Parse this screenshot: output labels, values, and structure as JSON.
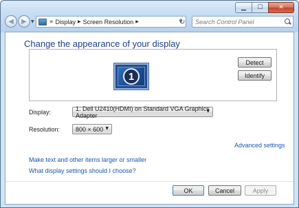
{
  "window": {
    "caption": {
      "minimize_glyph": "▁",
      "maximize_glyph": "☐",
      "close_glyph": "✕"
    }
  },
  "nav": {
    "back_glyph": "◀",
    "forward_glyph": "▶",
    "dropdown_glyph": "▼",
    "refresh_glyph": "↻"
  },
  "address": {
    "overflow": "«",
    "crumbs": [
      "Display",
      "Screen Resolution"
    ],
    "separator": "▶",
    "dropdown_glyph": "▼"
  },
  "search": {
    "placeholder": "Search Control Panel"
  },
  "page": {
    "title": "Change the appearance of your display"
  },
  "preview": {
    "monitor_number": "1",
    "detect_label": "Detect",
    "identify_label": "Identify"
  },
  "settings": {
    "display_label": "Display:",
    "display_value": "1. Dell U2410(HDMI) on Standard VGA Graphics Adapter",
    "resolution_label": "Resolution:",
    "resolution_value": "800 × 600",
    "dropdown_glyph": "▼"
  },
  "links": {
    "advanced": "Advanced settings",
    "text_size": "Make text and other items larger or smaller",
    "which_settings": "What display settings should I choose?"
  },
  "footer": {
    "ok": "OK",
    "cancel": "Cancel",
    "apply": "Apply"
  }
}
